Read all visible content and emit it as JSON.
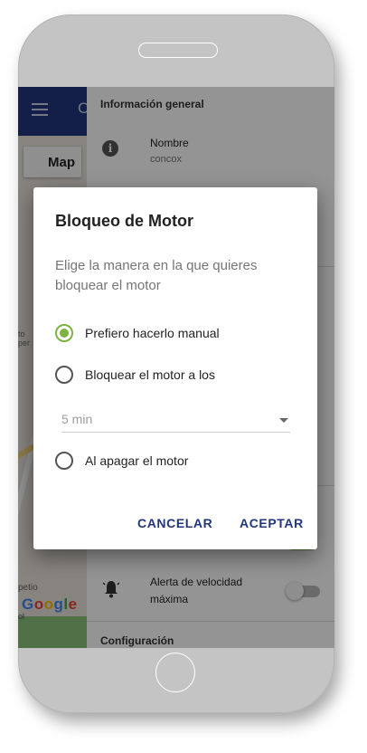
{
  "map": {
    "tab_label": "Map",
    "topbar_letter": "C",
    "place_text_1": "to\nper",
    "place_text_2": "petio",
    "google_logo": [
      "G",
      "o",
      "o",
      "g",
      "l",
      "e"
    ],
    "place_text_3": "ol"
  },
  "panel": {
    "header": "Información general",
    "info": {
      "label": "Nombre",
      "value": "concox"
    },
    "speed_alert": {
      "label": "Alerta de velocidad máxima",
      "enabled": false
    },
    "config_header": "Configuración"
  },
  "dialog": {
    "title": "Bloqueo de Motor",
    "message": "Elige la manera en la que quieres bloquear el motor",
    "options": [
      {
        "label": "Prefiero hacerlo manual",
        "checked": true
      },
      {
        "label": "Bloquear el motor a los",
        "checked": false
      },
      {
        "label": "Al apagar el motor",
        "checked": false
      }
    ],
    "select_value": "5 min",
    "cancel_label": "CANCELAR",
    "accept_label": "ACEPTAR"
  },
  "colors": {
    "accent_green": "#7cb342",
    "primary_blue": "#22367e"
  }
}
